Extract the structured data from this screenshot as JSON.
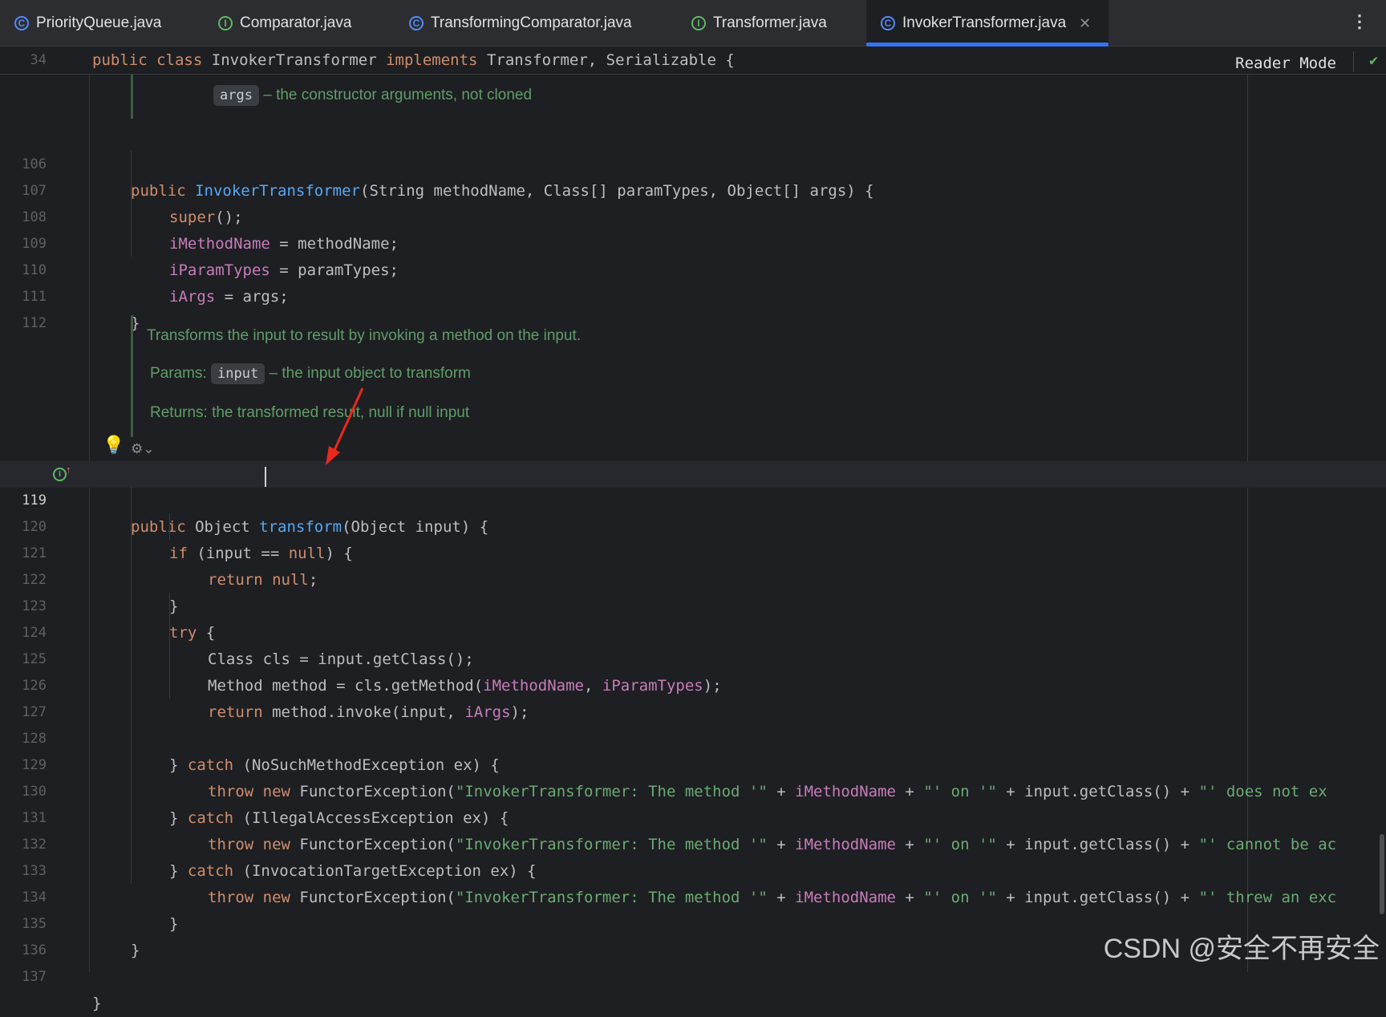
{
  "tabs": [
    {
      "label": "PriorityQueue.java",
      "icon": "class-icon",
      "kind": "class"
    },
    {
      "label": "Comparator.java",
      "icon": "interface-icon",
      "kind": "iface"
    },
    {
      "label": "TransformingComparator.java",
      "icon": "class-icon",
      "kind": "class"
    },
    {
      "label": "Transformer.java",
      "icon": "interface-icon",
      "kind": "iface"
    },
    {
      "label": "InvokerTransformer.java",
      "icon": "class-icon",
      "kind": "class",
      "active": true
    }
  ],
  "reader_mode": "Reader Mode",
  "sticky": {
    "line_number": "34",
    "kw1": "public",
    "kw2": "class",
    "name": "InvokerTransformer",
    "kw3": "implements",
    "rest": "Transformer, Serializable {"
  },
  "doc_top": {
    "chip": "args",
    "text": "– the constructor arguments, not cloned"
  },
  "doc_transform": {
    "summary": "Transforms the input to result by invoking a method on the input.",
    "params_label": "Params:",
    "param_chip": "input",
    "param_text": "– the input object to transform",
    "returns": "Returns: the transformed result, null if null input"
  },
  "line_numbers": [
    "106",
    "107",
    "108",
    "109",
    "110",
    "111",
    "112",
    "119",
    "120",
    "121",
    "122",
    "123",
    "124",
    "125",
    "126",
    "127",
    "128",
    "129",
    "130",
    "131",
    "132",
    "133",
    "134",
    "135",
    "136",
    "137"
  ],
  "code": {
    "l106": {
      "kw": "public",
      "fn": "InvokerTransformer",
      "rest": "(String methodName, Class[] paramTypes, Object[] args) {"
    },
    "l107": {
      "kw": "super",
      "rest": "();"
    },
    "l108": {
      "fld": "iMethodName",
      "rest": " = methodName;"
    },
    "l109": {
      "fld": "iParamTypes",
      "rest": " = paramTypes;"
    },
    "l110": {
      "fld": "iArgs",
      "rest": " = args;"
    },
    "l111": "}",
    "l119": {
      "kw": "public",
      "type": " Object ",
      "fn": "transform",
      "rest": "(Object input) {"
    },
    "l120": {
      "kw": "if",
      "a": " (input == ",
      "kw2": "null",
      "b": ") {"
    },
    "l121": {
      "kw": "return",
      "kw2": " null",
      "b": ";"
    },
    "l122": "}",
    "l123": {
      "kw": "try",
      "b": " {"
    },
    "l124": "Class cls = input.getClass();",
    "l125": {
      "a": "Method method = cls.getMethod(",
      "f1": "iMethodName",
      "c": ", ",
      "f2": "iParamTypes",
      "d": ");"
    },
    "l126": {
      "kw": "return",
      "a": " method.invoke(input, ",
      "f1": "iArgs",
      "b": ");"
    },
    "l128": {
      "a": "} ",
      "kw": "catch",
      "b": " (NoSuchMethodException ex) {"
    },
    "l129": {
      "s2": "\"' does not ex"
    },
    "l130": {
      "a": "} ",
      "kw": "catch",
      "b": " (IllegalAccessException ex) {"
    },
    "l131": {
      "s2": "\"' cannot be ac"
    },
    "l132": {
      "a": "} ",
      "kw": "catch",
      "b": " (InvocationTargetException ex) {"
    },
    "l133": {
      "s2": "\"' threw an exc"
    },
    "l134": "}",
    "l135": "}",
    "l137": "}"
  },
  "throw_line": {
    "kw1": "throw",
    "kw2": " new",
    "a": " FunctorException(",
    "s1": "\"InvokerTransformer: The method '\"",
    "p1": " + ",
    "f1": "iMethodName",
    "p2": " + ",
    "s_on": "\"' on '\"",
    "p3": " + input.getClass() + "
  },
  "watermark": "CSDN @安全不再安全",
  "colors": {
    "accent": "#3574f0",
    "keyword": "#cf8e6d",
    "function": "#56a8f5",
    "field": "#c77dbb",
    "string": "#6aab73",
    "doc": "#5f9e68"
  }
}
